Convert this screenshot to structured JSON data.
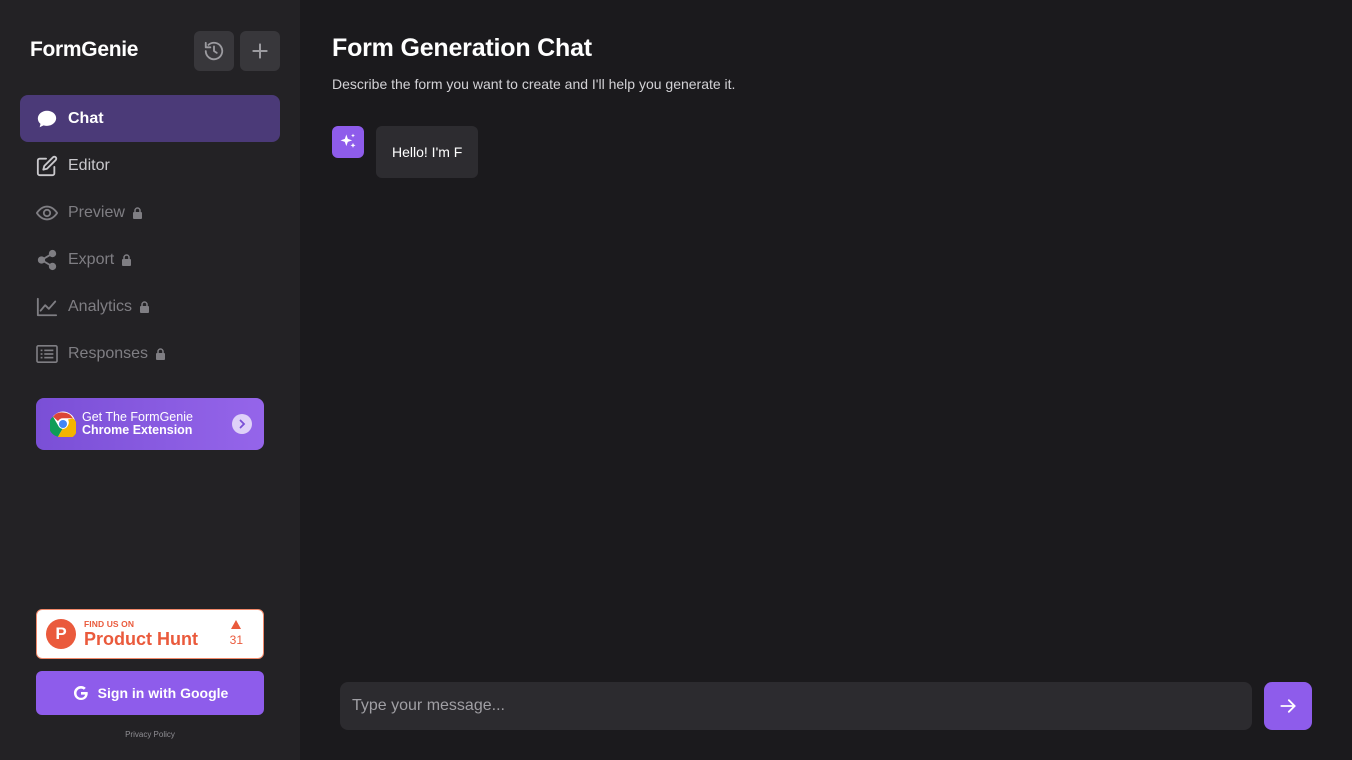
{
  "app": {
    "brand": "FormGenie"
  },
  "sidebar": {
    "history_icon": "history-icon",
    "new_chat_icon": "plus-icon",
    "items": [
      {
        "label": "Chat",
        "icon": "chat-bubble-icon",
        "state": "active",
        "locked": false
      },
      {
        "label": "Editor",
        "icon": "edit-icon",
        "state": "normal",
        "locked": false
      },
      {
        "label": "Preview",
        "icon": "eye-icon",
        "state": "locked",
        "locked": true
      },
      {
        "label": "Export",
        "icon": "share-icon",
        "state": "locked",
        "locked": true
      },
      {
        "label": "Analytics",
        "icon": "chart-line-icon",
        "state": "locked",
        "locked": true
      },
      {
        "label": "Responses",
        "icon": "list-icon",
        "state": "locked",
        "locked": true
      }
    ],
    "chrome_banner": {
      "line1": "Get The FormGenie",
      "line2": "Chrome Extension"
    },
    "product_hunt": {
      "small": "FIND US ON",
      "big": "Product Hunt",
      "votes": "31"
    },
    "google_button": "Sign in with Google",
    "privacy": "Privacy Policy"
  },
  "main": {
    "title": "Form Generation Chat",
    "subtitle": "Describe the form you want to create and I'll help you generate it.",
    "messages": [
      {
        "role": "assistant",
        "text": "Hello! I'm F"
      }
    ],
    "input_placeholder": "Type your message..."
  },
  "colors": {
    "accent": "#8e5ceb",
    "active_nav": "#4b3a78",
    "sidebar_bg": "#232225",
    "main_bg": "#1b1a1d",
    "product_hunt": "#ea5a3c"
  }
}
